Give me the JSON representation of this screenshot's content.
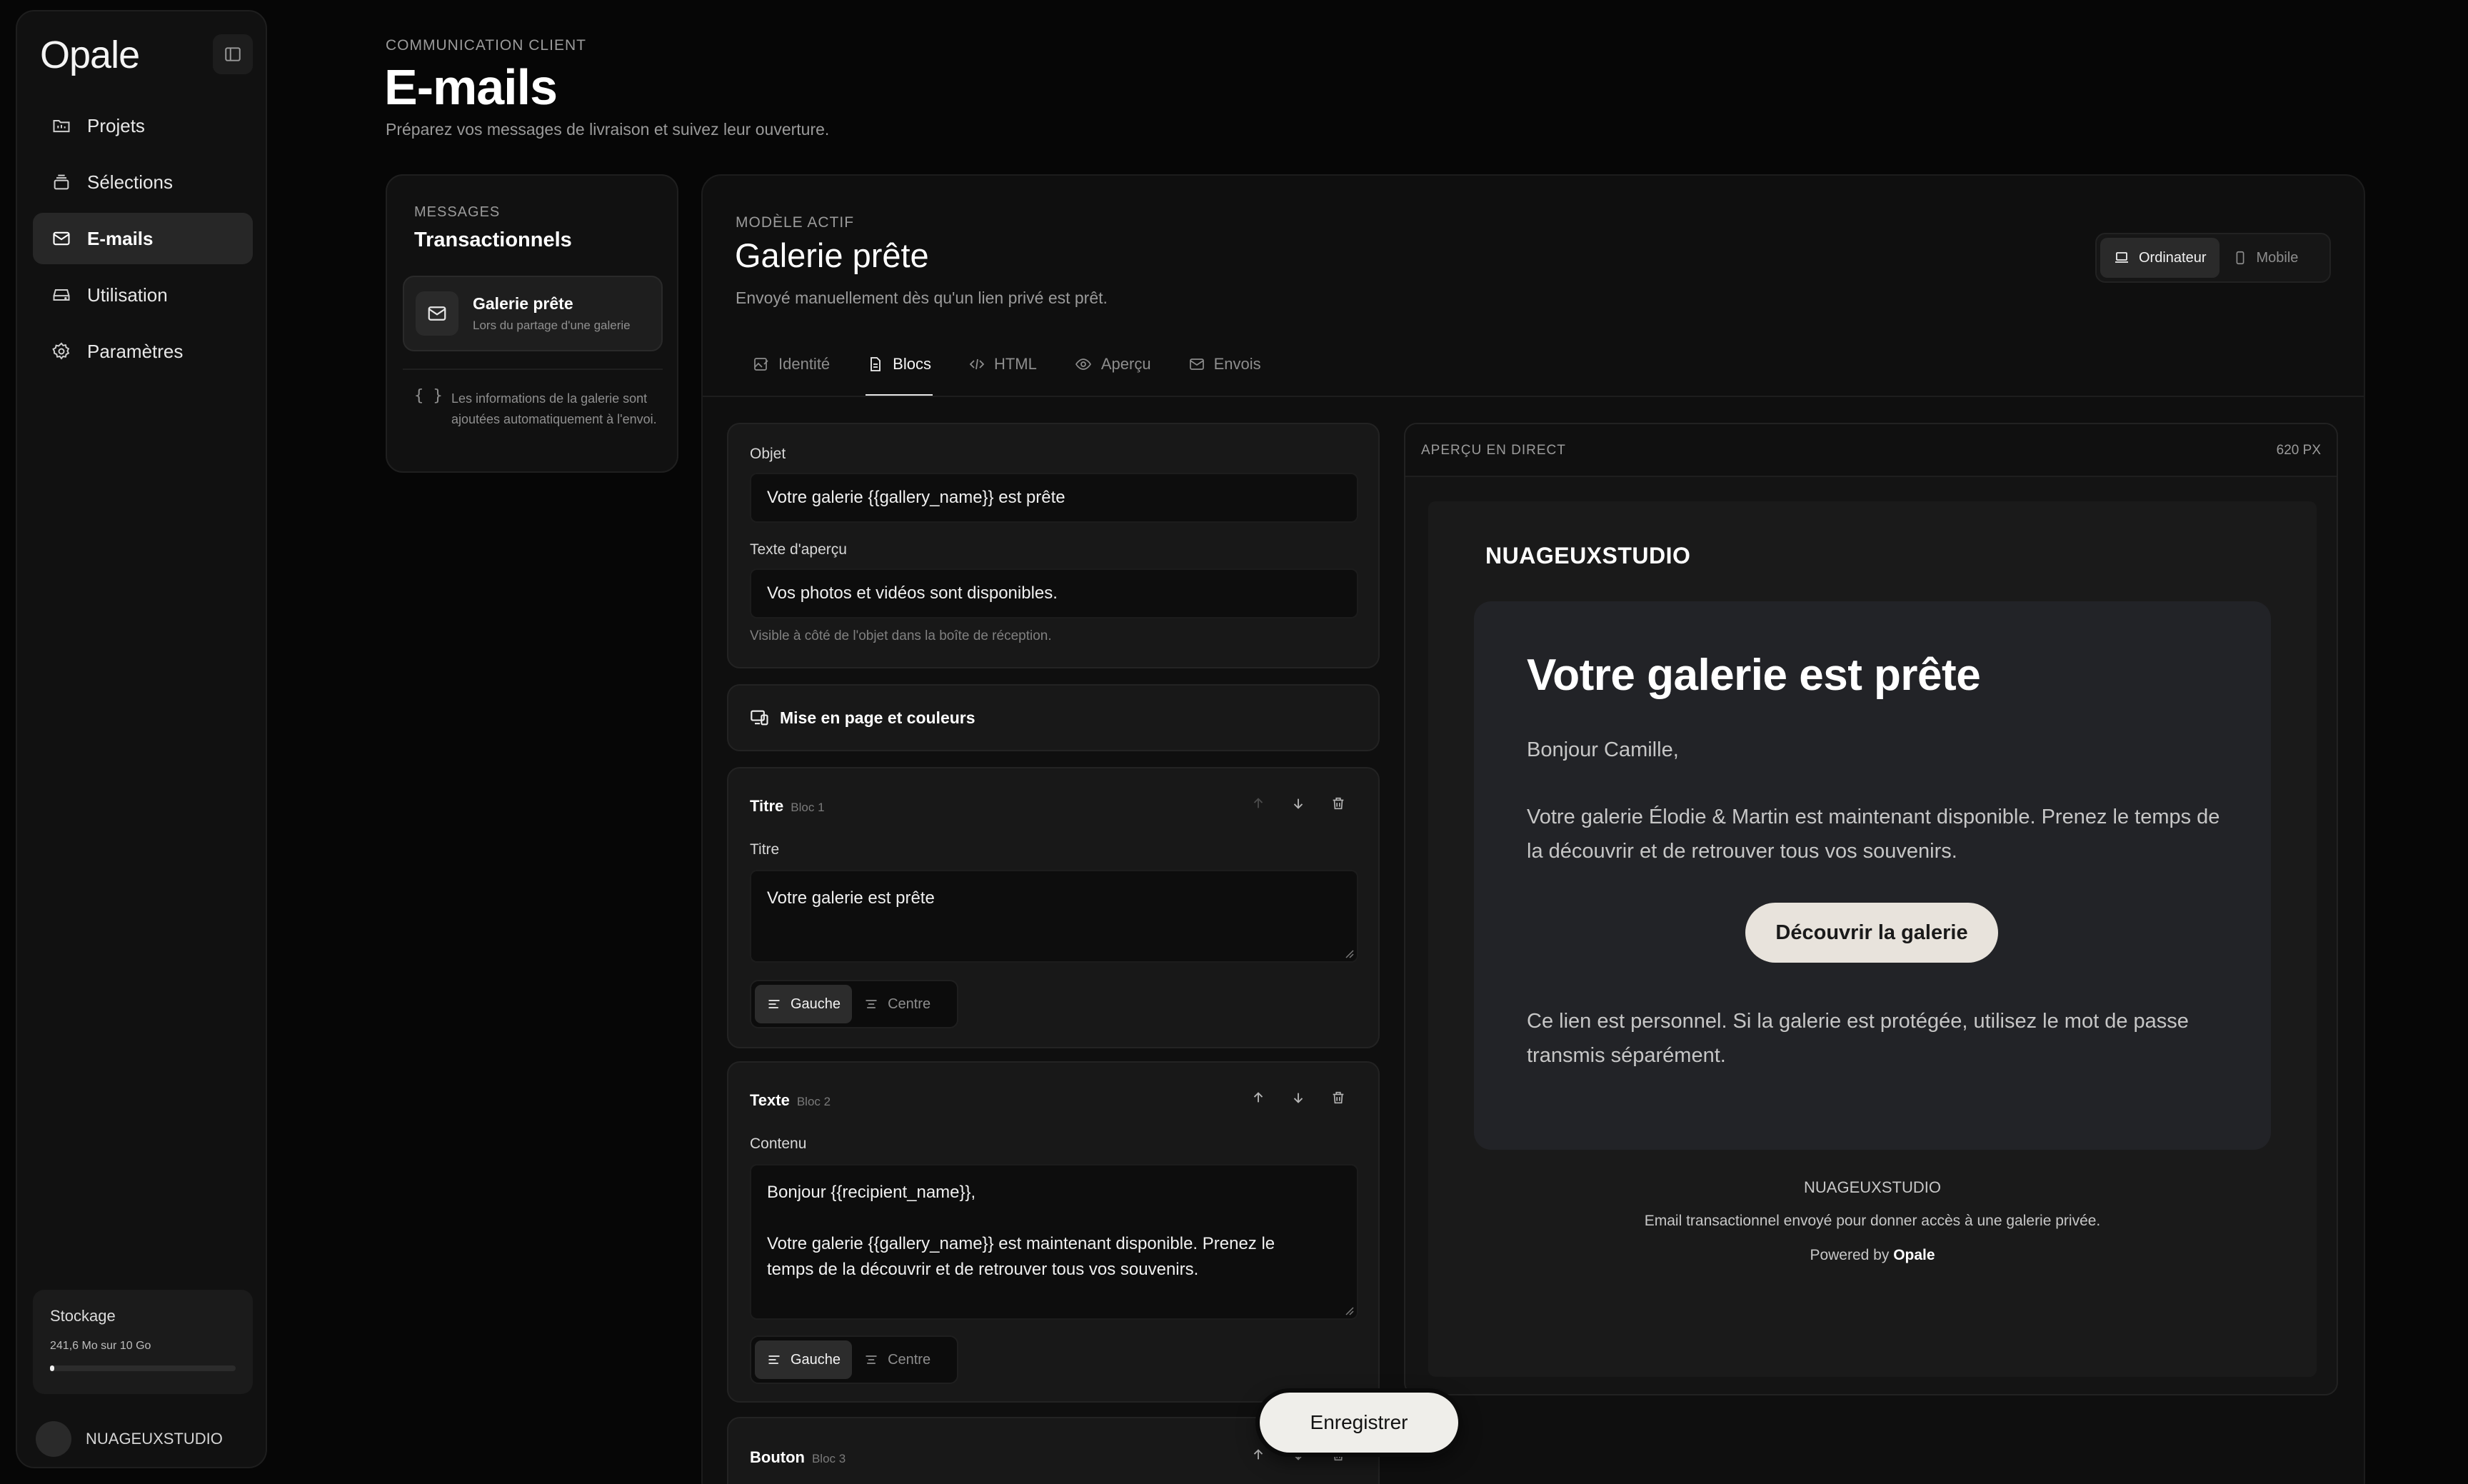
{
  "sidebar": {
    "logo": "Opale",
    "nav": [
      {
        "label": "Projets",
        "icon": "folder-icon"
      },
      {
        "label": "Sélections",
        "icon": "stack-icon"
      },
      {
        "label": "E-mails",
        "icon": "mail-icon",
        "active": true
      },
      {
        "label": "Utilisation",
        "icon": "drive-icon"
      },
      {
        "label": "Paramètres",
        "icon": "gear-icon"
      }
    ],
    "storage": {
      "title": "Stockage",
      "usage": "241,6 Mo sur 10 Go",
      "used_fraction": 0.024
    },
    "account": {
      "name": "NUAGEUXSTUDIO"
    }
  },
  "header": {
    "eyebrow": "COMMUNICATION CLIENT",
    "title": "E-mails",
    "subtitle": "Préparez vos messages de livraison et suivez leur ouverture."
  },
  "messages": {
    "label": "MESSAGES",
    "title": "Transactionnels",
    "items": [
      {
        "name": "Galerie prête",
        "desc": "Lors du partage d'une galerie"
      }
    ],
    "note_icon": "{ }",
    "note": "Les informations de la galerie sont ajoutées automatiquement à l'envoi."
  },
  "template": {
    "eyebrow": "MODÈLE ACTIF",
    "title": "Galerie prête",
    "subtitle": "Envoyé manuellement dès qu'un lien privé est prêt.",
    "devices": [
      {
        "label": "Ordinateur",
        "active": true
      },
      {
        "label": "Mobile"
      }
    ],
    "tabs": [
      {
        "label": "Identité",
        "icon": "image-edit-icon"
      },
      {
        "label": "Blocs",
        "icon": "document-icon",
        "active": true
      },
      {
        "label": "HTML",
        "icon": "code-icon"
      },
      {
        "label": "Aperçu",
        "icon": "eye-icon"
      },
      {
        "label": "Envois",
        "icon": "mail-icon"
      }
    ]
  },
  "form": {
    "subject_label": "Objet",
    "subject_value": "Votre galerie {{gallery_name}} est prête",
    "preview_label": "Texte d'aperçu",
    "preview_value": "Vos photos et vidéos sont disponibles.",
    "preview_hint": "Visible à côté de l'objet dans la boîte de réception.",
    "layout_label": "Mise en page et couleurs",
    "blocks": [
      {
        "title": "Titre",
        "sub": "Bloc 1",
        "field_label": "Titre",
        "value": "Votre galerie est prête",
        "align": [
          "Gauche",
          "Centre"
        ]
      },
      {
        "title": "Texte",
        "sub": "Bloc 2",
        "field_label": "Contenu",
        "value": "Bonjour {{recipient_name}},\n\nVotre galerie {{gallery_name}} est maintenant disponible. Prenez le\ntemps de la découvrir et de retrouver tous vos souvenirs.",
        "align": [
          "Gauche",
          "Centre"
        ]
      },
      {
        "title": "Bouton",
        "sub": "Bloc 3"
      }
    ],
    "save_label": "Enregistrer"
  },
  "preview": {
    "label": "APERÇU EN DIRECT",
    "width_label": "620 PX",
    "brand": "NUAGEUXSTUDIO",
    "heading": "Votre galerie est prête",
    "greeting": "Bonjour Camille,",
    "body": "Votre galerie Élodie & Martin est maintenant disponible. Prenez le temps de la découvrir et de retrouver tous vos souvenirs.",
    "button": "Découvrir la galerie",
    "note": "Ce lien est personnel. Si la galerie est protégée, utilisez le mot de passe transmis séparément.",
    "footer_brand": "NUAGEUXSTUDIO",
    "footer_text": "Email transactionnel envoyé pour donner accès à une galerie privée.",
    "powered_prefix": "Powered by",
    "powered_brand": "Opale"
  }
}
